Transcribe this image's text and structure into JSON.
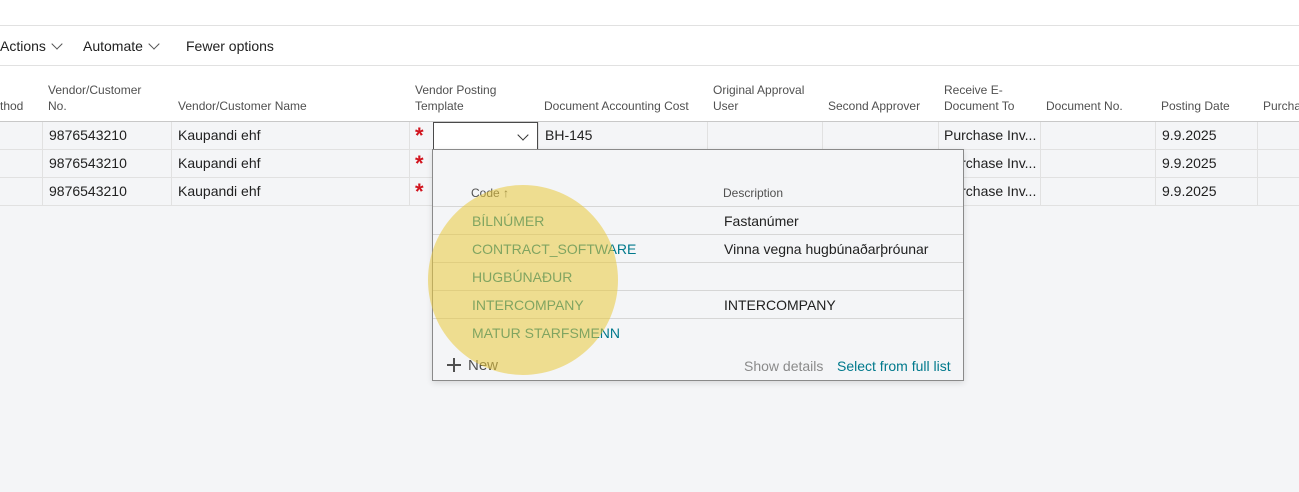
{
  "actionbar": {
    "actions_label": "Actions",
    "automate_label": "Automate",
    "fewer_options_label": "Fewer options"
  },
  "columns": {
    "method": "thod",
    "vendor_customer_no": "Vendor/Customer No.",
    "vendor_customer_name": "Vendor/Customer Name",
    "vendor_posting_template": "Vendor Posting Template",
    "document_accounting_cost": "Document Accounting Cost",
    "original_approval_user": "Original Approval User",
    "second_approver": "Second Approver",
    "receive_edocument_to": "Receive E-Document To",
    "document_no": "Document No.",
    "posting_date": "Posting Date",
    "purchase": "Purcha"
  },
  "rows": [
    {
      "vendor_no": "9876543210",
      "vendor_name": "Kaupandi ehf",
      "accounting_cost": "BH-145",
      "receive_to": "Purchase Inv...",
      "posting_date": "9.9.2025"
    },
    {
      "vendor_no": "9876543210",
      "vendor_name": "Kaupandi ehf",
      "accounting_cost": "",
      "receive_to": "Purchase Inv...",
      "posting_date": "9.9.2025"
    },
    {
      "vendor_no": "9876543210",
      "vendor_name": "Kaupandi ehf",
      "accounting_cost": "",
      "receive_to": "Purchase Inv...",
      "posting_date": "9.9.2025"
    }
  ],
  "dropdown": {
    "code_header": "Code ↑",
    "description_header": "Description",
    "items": [
      {
        "code": "BÍLNÚMER",
        "description": "Fastanúmer"
      },
      {
        "code": "CONTRACT_SOFTWARE",
        "description": "Vinna vegna hugbúnaðarþróunar"
      },
      {
        "code": "HUGBÚNAÐUR",
        "description": ""
      },
      {
        "code": "INTERCOMPANY",
        "description": "INTERCOMPANY"
      },
      {
        "code": "MATUR STARFSMENN",
        "description": ""
      }
    ],
    "new_label": "New",
    "show_details_label": "Show details",
    "select_full_list_label": "Select from full list"
  },
  "colors": {
    "link": "#00798c",
    "required": "#d1141e",
    "highlight": "#eac83c"
  }
}
